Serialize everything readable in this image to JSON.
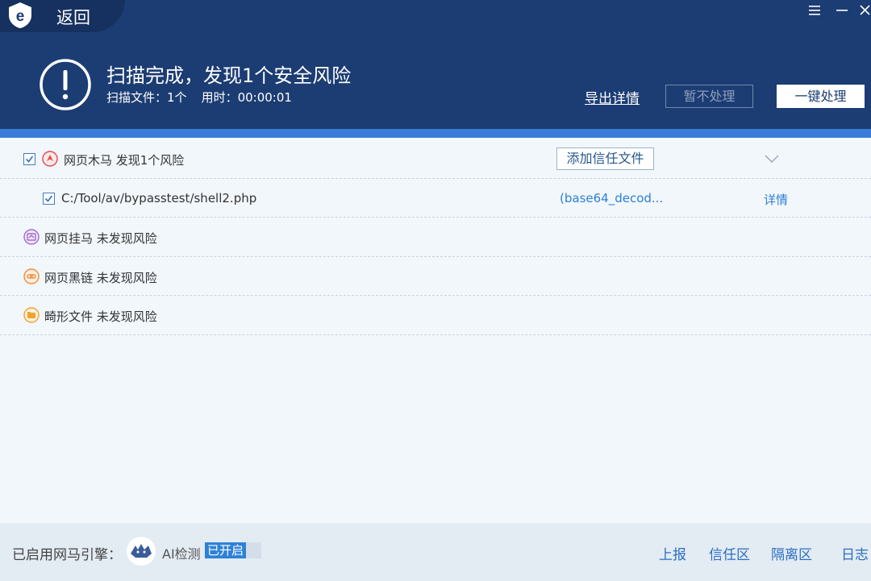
{
  "titlebar": {
    "back_label": "返回",
    "logo_icon": "shield-e-logo-icon",
    "window_buttons": [
      "menu-icon",
      "minimize-icon",
      "close-icon"
    ]
  },
  "summary": {
    "title": "扫描完成，发现1个安全风险",
    "files_label": "扫描文件：",
    "files_value": "1个",
    "time_label": "用时：",
    "time_value": "00:00:01",
    "status_icon": "warning-exclamation-icon"
  },
  "actions": {
    "export": "导出详情",
    "ignore": "暂不处理",
    "fix_all": "一键处理"
  },
  "categories": [
    {
      "label": "网页木马 发现1个风险",
      "icon": "webshell-trojan-icon",
      "color": "#e5484d",
      "checked": true,
      "expanded": true
    },
    {
      "label": "网页挂马 未发现风险",
      "icon": "web-hang-horse-icon",
      "color": "#a36bd1"
    },
    {
      "label": "网页黑链 未发现风险",
      "icon": "black-link-icon",
      "color": "#f08c3a"
    },
    {
      "label": "畸形文件 未发现风险",
      "icon": "malformed-file-icon",
      "color": "#f0a32e"
    }
  ],
  "trust_button": "添加信任文件",
  "findings": [
    {
      "path": "C:/Tool/av/bypasstest/shell2.php",
      "threat": "(base64_decod...",
      "detail": "详情",
      "checked": true
    }
  ],
  "footer": {
    "engine_label": "已启用网马引擎：",
    "ai_label": "AI检测",
    "ai_status": "已开启",
    "links": [
      "上报",
      "信任区",
      "隔离区",
      "日志"
    ]
  },
  "colors": {
    "header": "#1c3d73",
    "accent": "#3a7dd8",
    "link": "#2b7fd8",
    "background": "#f2f7fb"
  }
}
